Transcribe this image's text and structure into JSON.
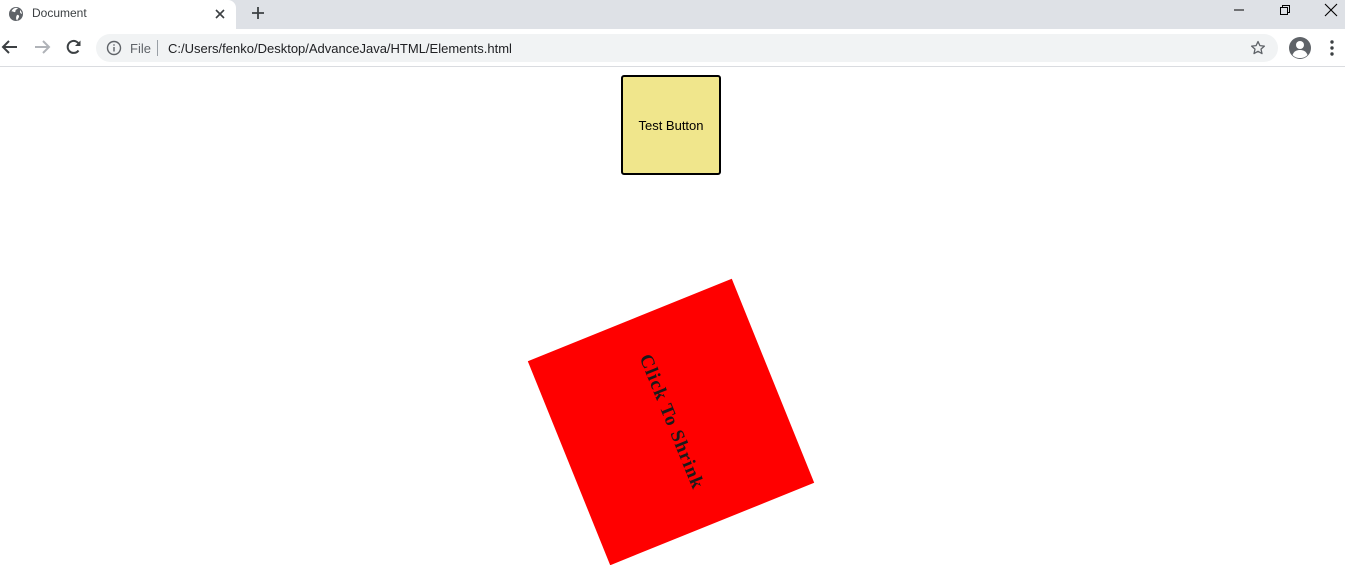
{
  "browser": {
    "tab": {
      "title": "Document"
    },
    "address_bar": {
      "scheme_label": "File",
      "url": "C:/Users/fenko/Desktop/AdvanceJava/HTML/Elements.html"
    }
  },
  "page": {
    "test_button_label": "Test Button",
    "shrink_box_label": "Click To Shrink"
  },
  "colors": {
    "test_button_bg": "#f0e68c",
    "shrink_box_bg": "#ff0000",
    "tabstrip_bg": "#dee1e6",
    "omnibox_bg": "#f1f3f4"
  }
}
